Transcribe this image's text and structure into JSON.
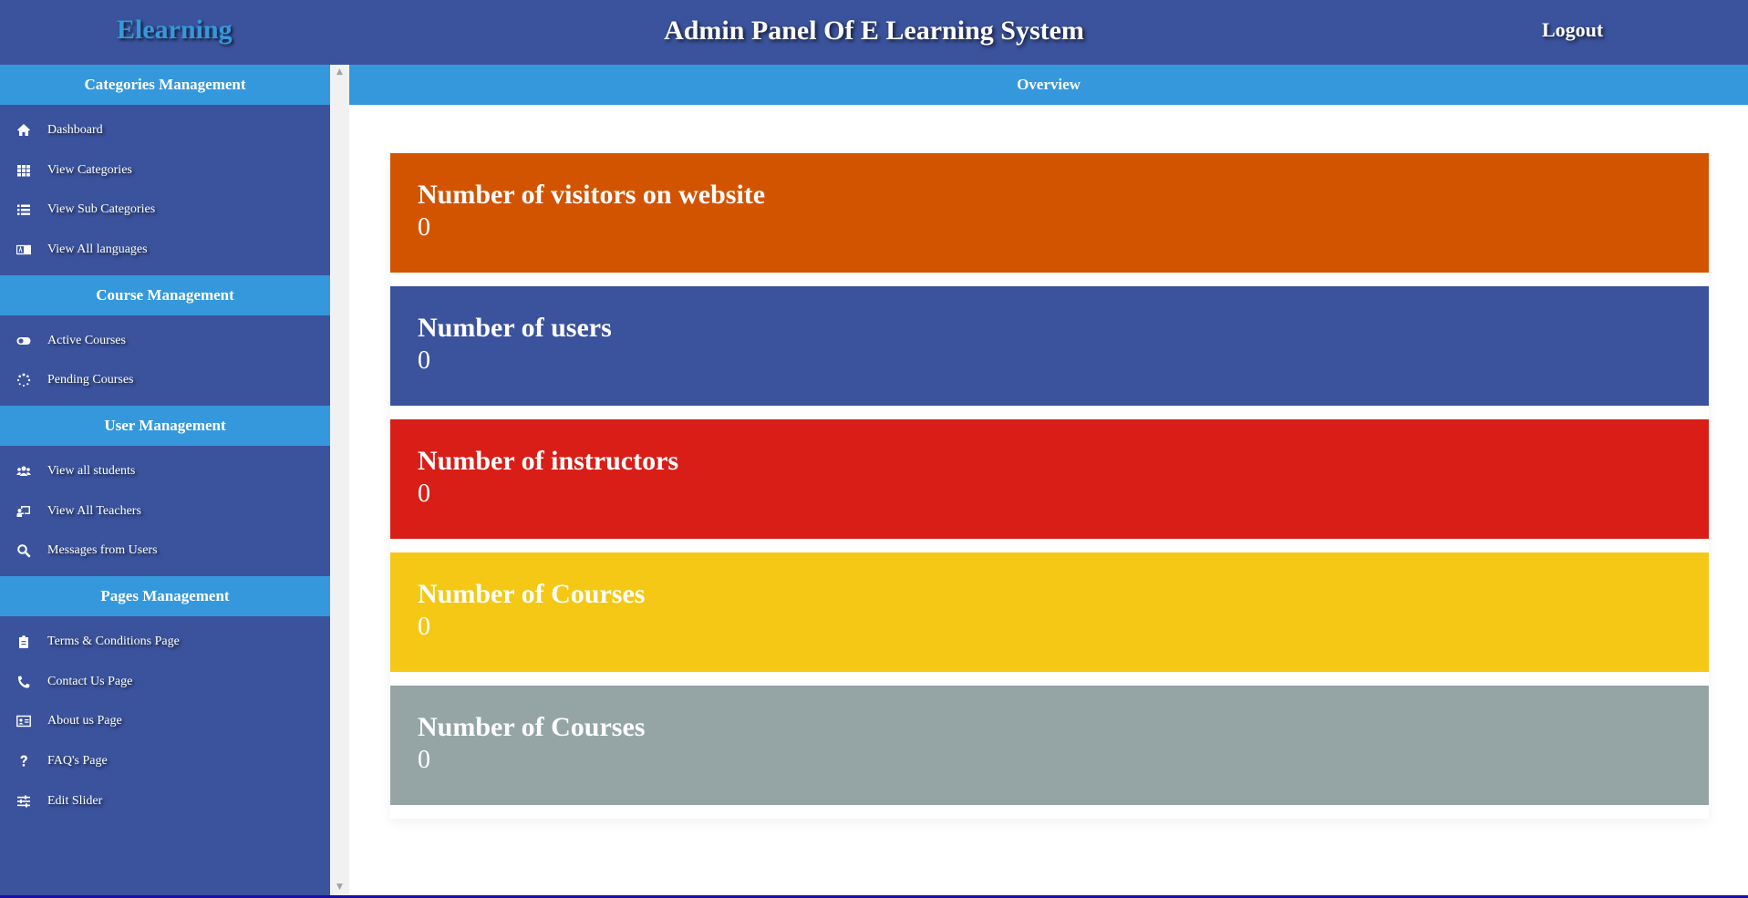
{
  "header": {
    "brand": "Elearning",
    "title": "Admin Panel Of E Learning System",
    "logout_label": "Logout"
  },
  "sidebar": {
    "sections": [
      {
        "title": "Categories Management",
        "items": [
          {
            "label": "Dashboard",
            "icon": "home-icon"
          },
          {
            "label": "View Categories",
            "icon": "grid-icon"
          },
          {
            "label": "View Sub Categories",
            "icon": "list-icon"
          },
          {
            "label": "View All languages",
            "icon": "language-icon"
          }
        ]
      },
      {
        "title": "Course Management",
        "items": [
          {
            "label": "Active Courses",
            "icon": "toggle-on-icon"
          },
          {
            "label": "Pending Courses",
            "icon": "spinner-icon"
          }
        ]
      },
      {
        "title": "User Management",
        "items": [
          {
            "label": "View all students",
            "icon": "users-icon"
          },
          {
            "label": "View All Teachers",
            "icon": "chalkboard-teacher-icon"
          },
          {
            "label": "Messages from Users",
            "icon": "search-icon"
          }
        ]
      },
      {
        "title": "Pages Management",
        "items": [
          {
            "label": "Terms & Conditions Page",
            "icon": "clipboard-icon"
          },
          {
            "label": "Contact Us Page",
            "icon": "phone-icon"
          },
          {
            "label": "About us Page",
            "icon": "id-card-icon"
          },
          {
            "label": "FAQ's Page",
            "icon": "question-icon"
          },
          {
            "label": "Edit Slider",
            "icon": "sliders-icon"
          }
        ]
      }
    ]
  },
  "main": {
    "header": "Overview",
    "cards": [
      {
        "title": "Number of visitors on website",
        "value": "0",
        "color": "#d35400"
      },
      {
        "title": "Number of users",
        "value": "0",
        "color": "#3b539d"
      },
      {
        "title": "Number of instructors",
        "value": "0",
        "color": "#d91e18"
      },
      {
        "title": "Number of Courses",
        "value": "0",
        "color": "#f5c816"
      },
      {
        "title": "Number of Courses",
        "value": "0",
        "color": "#95a5a6"
      }
    ]
  },
  "colors": {
    "primary": "#3b539d",
    "accent": "#3598dc"
  }
}
